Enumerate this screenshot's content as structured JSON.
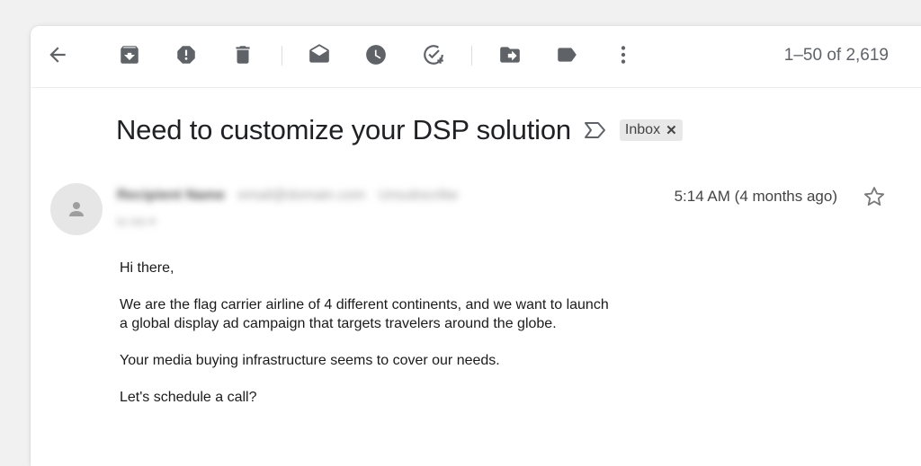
{
  "toolbar": {
    "buttons": [
      {
        "icon": "back-arrow-icon"
      },
      {
        "icon": "archive-icon"
      },
      {
        "icon": "report-spam-icon"
      },
      {
        "icon": "delete-icon"
      },
      {
        "icon": "mark-unread-icon"
      },
      {
        "icon": "snooze-icon"
      },
      {
        "icon": "add-to-tasks-icon"
      },
      {
        "icon": "move-to-icon"
      },
      {
        "icon": "labels-icon"
      },
      {
        "icon": "more-vert-icon"
      }
    ],
    "pager": "1–50 of 2,619"
  },
  "email": {
    "subject": "Need to customize your DSP solution",
    "label": "Inbox",
    "label_remove": "✕",
    "sender_name": "Recipient Name",
    "sender_email": "email@domain.com",
    "sender_unsubscribe": "Unsubscribe",
    "to_line": "to me ▾",
    "timestamp": "5:14 AM (4 months ago)",
    "body": {
      "greeting": "Hi there,",
      "line1": "We are the flag carrier airline of 4 different continents, and we want to launch",
      "line2": "a global display ad campaign that targets travelers around the globe.",
      "line3": "Your media buying infrastructure seems to cover our needs.",
      "line4": "Let's schedule a call?"
    }
  },
  "colors": {
    "icon": "#5f6368",
    "background": "#f1f1f1",
    "card": "#ffffff"
  }
}
